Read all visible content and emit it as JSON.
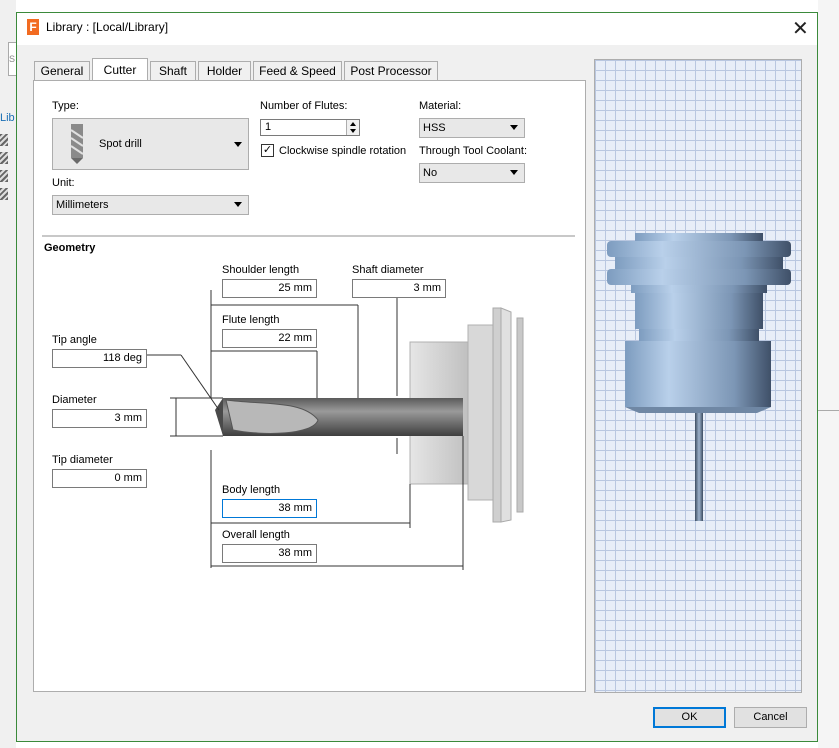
{
  "window": {
    "title": "Library :  [Local/Library]",
    "icon_letter": "F",
    "accent": "#f26b21"
  },
  "background_app": {
    "tab_fragment": "Lib",
    "search_fragment": "S"
  },
  "tabs": [
    {
      "label": "General",
      "active": false
    },
    {
      "label": "Cutter",
      "active": true
    },
    {
      "label": "Shaft",
      "active": false
    },
    {
      "label": "Holder",
      "active": false
    },
    {
      "label": "Feed & Speed",
      "active": false
    },
    {
      "label": "Post Processor",
      "active": false
    }
  ],
  "cutter": {
    "type_label": "Type:",
    "type_value": "Spot drill",
    "unit_label": "Unit:",
    "unit_value": "Millimeters",
    "flutes_label": "Number of Flutes:",
    "flutes_value": "1",
    "clockwise_label": "Clockwise spindle rotation",
    "clockwise_checked": true,
    "check_glyph": "✓",
    "material_label": "Material:",
    "material_value": "HSS",
    "coolant_label": "Through Tool Coolant:",
    "coolant_value": "No"
  },
  "geometry": {
    "title": "Geometry",
    "shoulder_length_label": "Shoulder length",
    "shoulder_length_value": "25 mm",
    "shaft_diameter_label": "Shaft diameter",
    "shaft_diameter_value": "3 mm",
    "flute_length_label": "Flute length",
    "flute_length_value": "22 mm",
    "tip_angle_label": "Tip angle",
    "tip_angle_value": "118 deg",
    "diameter_label": "Diameter",
    "diameter_value": "3 mm",
    "tip_diameter_label": "Tip diameter",
    "tip_diameter_value": "0 mm",
    "body_length_label": "Body length",
    "body_length_value": "38 mm",
    "overall_length_label": "Overall length",
    "overall_length_value": "38 mm"
  },
  "buttons": {
    "ok": "OK",
    "cancel": "Cancel"
  }
}
